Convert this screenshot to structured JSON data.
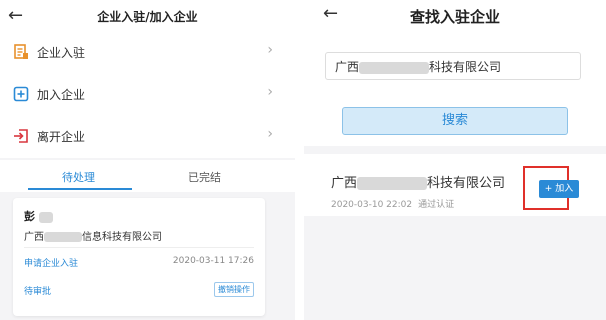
{
  "left": {
    "header": {
      "back_icon": "←",
      "title": "企业入驻/加入企业"
    },
    "menu": [
      {
        "icon": "document-enterprise-icon",
        "label": "企业入驻"
      },
      {
        "icon": "plus-square-icon",
        "label": "加入企业"
      },
      {
        "icon": "exit-icon",
        "label": "离开企业"
      }
    ],
    "tabs": [
      {
        "label": "待处理",
        "active": true
      },
      {
        "label": "已完结",
        "active": false
      }
    ],
    "card": {
      "name": "彭",
      "company_prefix": "广西",
      "company_suffix": "信息科技有限公司",
      "apply_label": "申请企业入驻",
      "date": "2020-03-11 17:26",
      "status": "待审批",
      "action": "撤销操作"
    }
  },
  "right": {
    "header": {
      "back_icon": "←",
      "title": "查找入驻企业"
    },
    "search": {
      "value_prefix": "广西",
      "value_suffix": "科技有限公司",
      "button_label": "搜索"
    },
    "result": {
      "name_prefix": "广西",
      "name_suffix": "科技有限公司",
      "date": "2020-03-10 22:02",
      "verified": "通过认证",
      "join_label": "+ 加入"
    }
  },
  "colors": {
    "accent": "#2a8ad6",
    "highlight": "#e0302a",
    "menu_icon": "#e8912c",
    "exit_icon": "#d9363e"
  }
}
